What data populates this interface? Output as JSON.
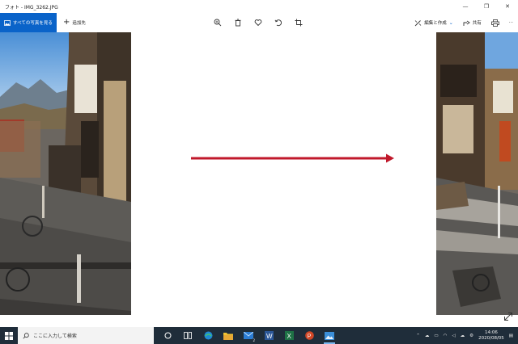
{
  "window": {
    "title": "フォト - IMG_3262.JPG",
    "controls": [
      "—",
      "❐",
      "✕"
    ]
  },
  "toolbar": {
    "all_photos_label": "すべての写真を見る",
    "add_to_label": "追加先",
    "edit_create_label": "編集と作成",
    "share_label": "共有",
    "more_label": "···"
  },
  "taskbar": {
    "search_placeholder": "ここに入力して検索",
    "time": "14:06",
    "date": "2020/08/05",
    "mail_badge": "2"
  },
  "colors": {
    "accent": "#0a63c9",
    "arrow": "#c0182b",
    "taskbar": "#1f2d3a"
  }
}
